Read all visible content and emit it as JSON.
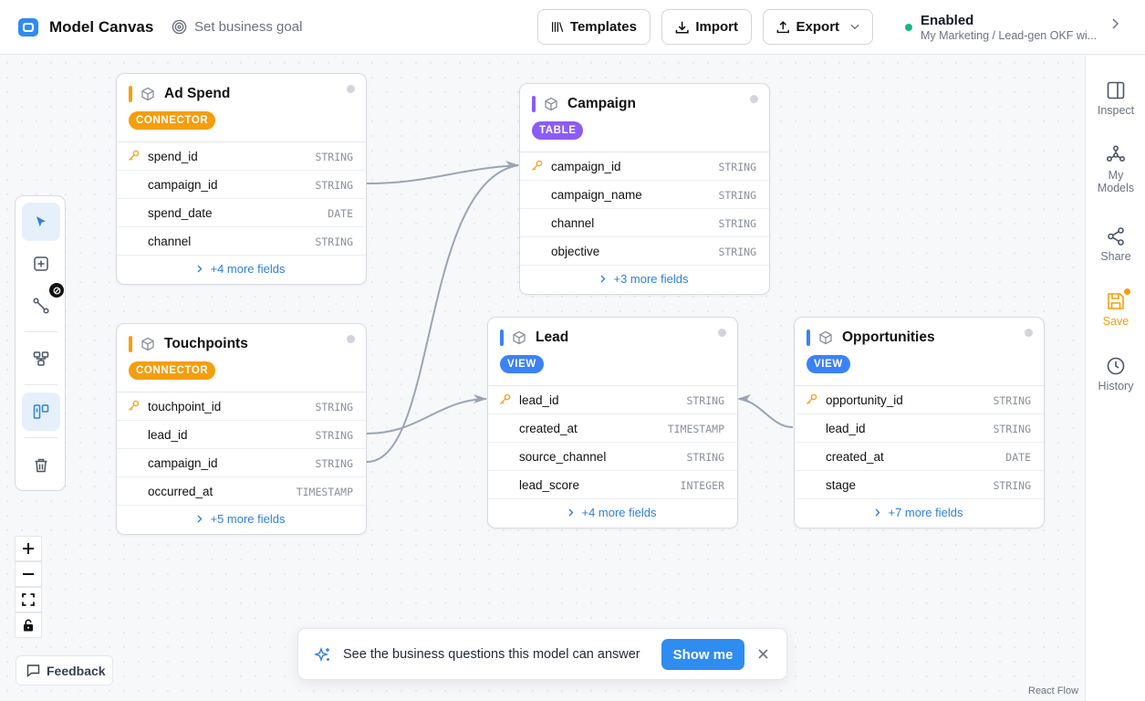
{
  "header": {
    "app_title": "Model Canvas",
    "goal_label": "Set business goal",
    "templates_label": "Templates",
    "import_label": "Import",
    "export_label": "Export",
    "status_title": "Enabled",
    "status_subtitle": "My Marketing / Lead-gen OKF wi..."
  },
  "right_sidebar": {
    "inspect": "Inspect",
    "my_models_1": "My",
    "my_models_2": "Models",
    "share": "Share",
    "save": "Save",
    "history": "History"
  },
  "nodes": {
    "ad_spend": {
      "title": "Ad Spend",
      "tag": "CONNECTOR",
      "fields": [
        {
          "name": "spend_id",
          "type": "STRING",
          "key": true
        },
        {
          "name": "campaign_id",
          "type": "STRING",
          "key": false
        },
        {
          "name": "spend_date",
          "type": "DATE",
          "key": false
        },
        {
          "name": "channel",
          "type": "STRING",
          "key": false
        }
      ],
      "more": "+4 more fields"
    },
    "campaign": {
      "title": "Campaign",
      "tag": "TABLE",
      "fields": [
        {
          "name": "campaign_id",
          "type": "STRING",
          "key": true
        },
        {
          "name": "campaign_name",
          "type": "STRING",
          "key": false
        },
        {
          "name": "channel",
          "type": "STRING",
          "key": false
        },
        {
          "name": "objective",
          "type": "STRING",
          "key": false
        }
      ],
      "more": "+3 more fields"
    },
    "touchpoints": {
      "title": "Touchpoints",
      "tag": "CONNECTOR",
      "fields": [
        {
          "name": "touchpoint_id",
          "type": "STRING",
          "key": true
        },
        {
          "name": "lead_id",
          "type": "STRING",
          "key": false
        },
        {
          "name": "campaign_id",
          "type": "STRING",
          "key": false
        },
        {
          "name": "occurred_at",
          "type": "TIMESTAMP",
          "key": false
        }
      ],
      "more": "+5 more fields"
    },
    "lead": {
      "title": "Lead",
      "tag": "VIEW",
      "fields": [
        {
          "name": "lead_id",
          "type": "STRING",
          "key": true
        },
        {
          "name": "created_at",
          "type": "TIMESTAMP",
          "key": false
        },
        {
          "name": "source_channel",
          "type": "STRING",
          "key": false
        },
        {
          "name": "lead_score",
          "type": "INTEGER",
          "key": false
        }
      ],
      "more": "+4 more fields"
    },
    "opportunities": {
      "title": "Opportunities",
      "tag": "VIEW",
      "fields": [
        {
          "name": "opportunity_id",
          "type": "STRING",
          "key": true
        },
        {
          "name": "lead_id",
          "type": "STRING",
          "key": false
        },
        {
          "name": "created_at",
          "type": "DATE",
          "key": false
        },
        {
          "name": "stage",
          "type": "STRING",
          "key": false
        }
      ],
      "more": "+7 more fields"
    }
  },
  "feedback_label": "Feedback",
  "toast": {
    "message": "See the business questions this model can answer",
    "button": "Show me"
  },
  "attribution": "React Flow",
  "colors": {
    "connector": "#f59e0b",
    "table": "#8b5cf6",
    "view": "#3b82f6",
    "accent": "#2f8cf0"
  }
}
